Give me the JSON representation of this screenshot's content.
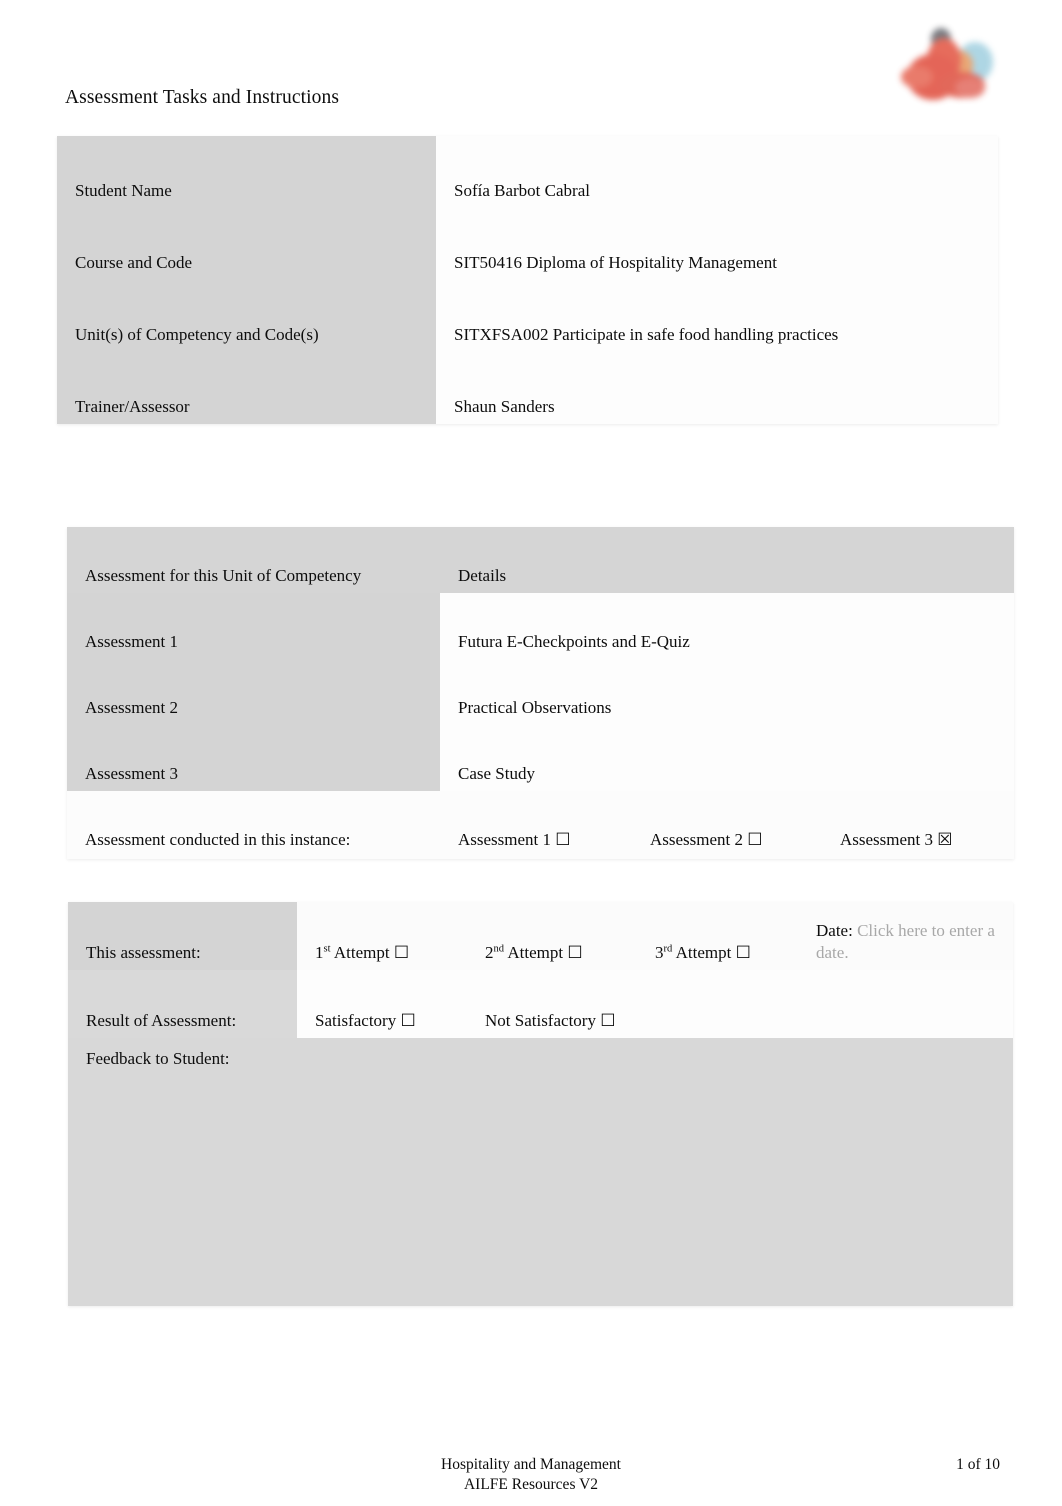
{
  "document": {
    "title": "Assessment Tasks and Instructions",
    "logo_icon": "college-logo-icon"
  },
  "student_table": {
    "rows": [
      {
        "label": "Student Name",
        "value": "Sofía Barbot Cabral"
      },
      {
        "label": "Course and Code",
        "value": "SIT50416 Diploma of Hospitality Management"
      },
      {
        "label": "Unit(s) of Competency and Code(s)",
        "value": "SITXFSA002 Participate in safe food handling practices"
      },
      {
        "label": "Trainer/Assessor",
        "value": "Shaun Sanders"
      }
    ]
  },
  "assessment_table": {
    "header": {
      "col1": "Assessment for this Unit of Competency",
      "col2": "Details"
    },
    "rows": [
      {
        "label": "Assessment 1",
        "value": "Futura E-Checkpoints and E-Quiz"
      },
      {
        "label": "Assessment 2",
        "value": "Practical Observations"
      },
      {
        "label": "Assessment 3",
        "value": "Case Study"
      }
    ],
    "conducted": {
      "label": "Assessment conducted in this instance:",
      "options": [
        {
          "label": "Assessment 1",
          "checked": false
        },
        {
          "label": "Assessment 2",
          "checked": false
        },
        {
          "label": "Assessment 3",
          "checked": true
        }
      ]
    }
  },
  "result_table": {
    "attempt_row": {
      "label": "This assessment:",
      "attempt1_prefix": "1",
      "attempt1_sup": "st",
      "attempt1_suffix": " Attempt",
      "attempt2_prefix": "2",
      "attempt2_sup": "nd",
      "attempt2_suffix": " Attempt",
      "attempt3_prefix": "3",
      "attempt3_sup": "rd",
      "attempt3_suffix": " Attempt",
      "date_label": "Date:",
      "date_placeholder": "Click here to enter a date."
    },
    "result_row": {
      "label": "Result of Assessment:",
      "satisfactory_label": "Satisfactory",
      "not_satisfactory_label": "Not Satisfactory"
    },
    "feedback_label": "Feedback to Student:",
    "feedback_value": ""
  },
  "footer": {
    "line1": "Hospitality and Management",
    "line2": "AILFE Resources V2",
    "page": "1 of 10"
  },
  "colors": {
    "header_grey": "#d5d5d5",
    "label_grey": "#d4d4d4",
    "feedback_grey": "#d8d8d8",
    "cell_white": "#fdfdfd",
    "placeholder_grey": "#a8a8a8",
    "text": "#0d0d0d"
  }
}
